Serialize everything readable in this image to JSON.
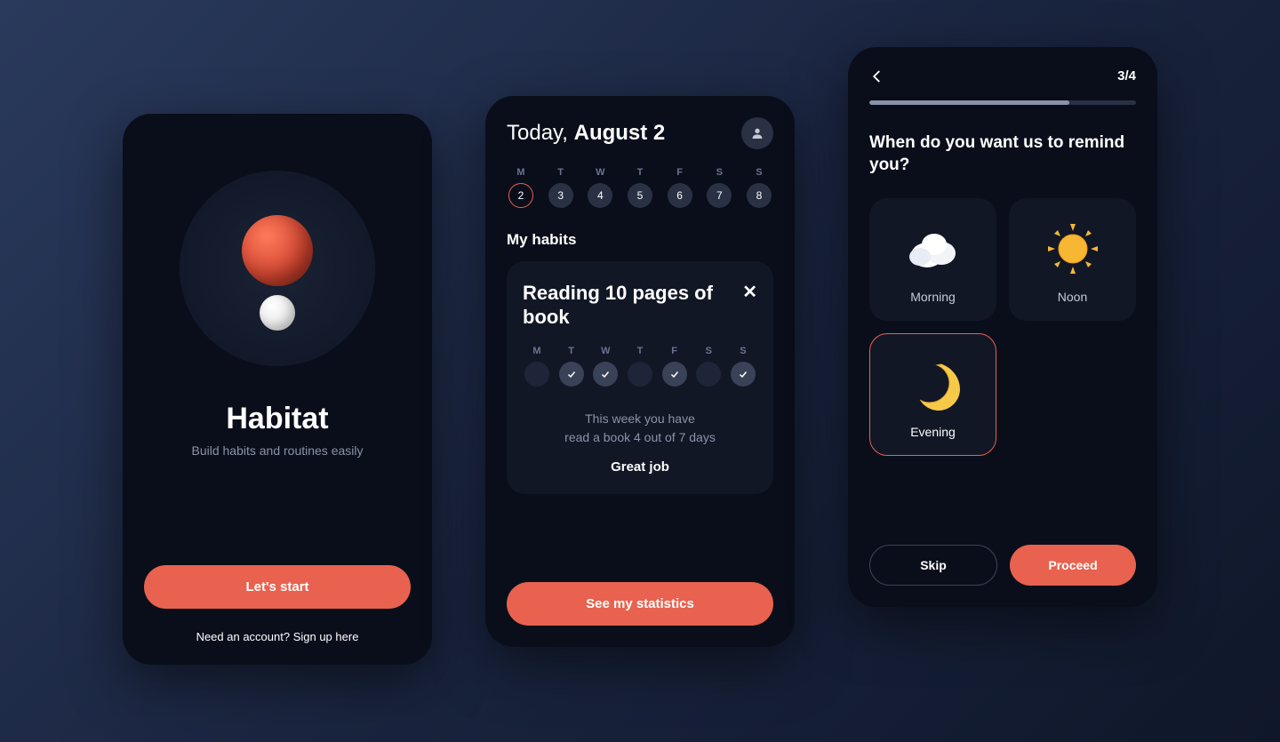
{
  "colors": {
    "accent": "#e8624f",
    "bg_dark": "#0a0e1a",
    "card": "#121726"
  },
  "welcome": {
    "title": "Habitat",
    "subtitle": "Build habits and routines easily",
    "start_button": "Let's start",
    "signup_link": "Need an account? Sign up here"
  },
  "dashboard": {
    "today_prefix": "Today, ",
    "today_date": "August 2",
    "week_days": [
      "M",
      "T",
      "W",
      "T",
      "F",
      "S",
      "S"
    ],
    "week_numbers": [
      "2",
      "3",
      "4",
      "5",
      "6",
      "7",
      "8"
    ],
    "active_day_index": 0,
    "section_title": "My habits",
    "habit": {
      "title": "Reading 10 pages of book",
      "week_days": [
        "M",
        "T",
        "W",
        "T",
        "F",
        "S",
        "S"
      ],
      "checks": [
        false,
        true,
        true,
        false,
        true,
        false,
        true
      ],
      "summary_line1": "This week you have",
      "summary_line2": "read a book 4 out of 7 days",
      "praise": "Great job"
    },
    "stats_button": "See my statistics"
  },
  "reminder": {
    "step": "3/4",
    "progress_percent": 75,
    "question": "When do you want us to remind you?",
    "options": [
      {
        "id": "morning",
        "label": "Morning",
        "icon": "cloud-icon",
        "selected": false
      },
      {
        "id": "noon",
        "label": "Noon",
        "icon": "sun-icon",
        "selected": false
      },
      {
        "id": "evening",
        "label": "Evening",
        "icon": "moon-icon",
        "selected": true
      }
    ],
    "skip_button": "Skip",
    "proceed_button": "Proceed"
  }
}
